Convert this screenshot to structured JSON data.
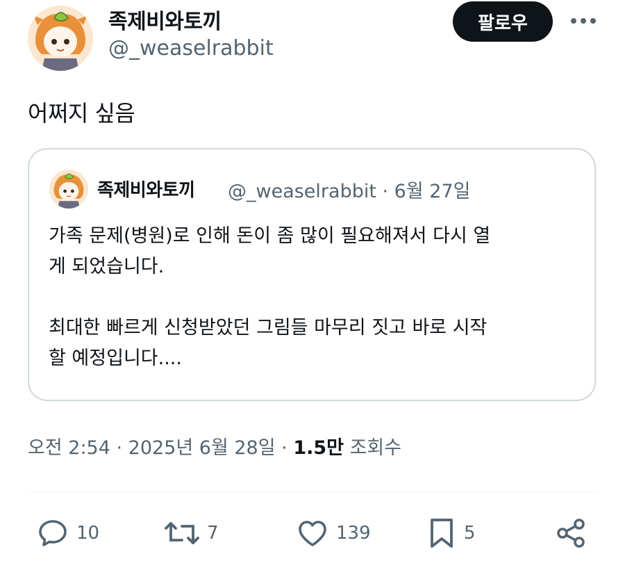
{
  "author": {
    "display_name": "족제비와토끼",
    "handle": "@_weaselrabbit",
    "avatar_icon": "avatar-illustration"
  },
  "follow_label": "팔로우",
  "more_icon": "more-icon",
  "tweet": {
    "text": "어쩌지 싶음"
  },
  "quoted": {
    "display_name": "족제비와토끼",
    "meta": "@_weaselrabbit · 6월 27일",
    "body": "가족 문제(병원)로 인해 돈이 좀 많이 필요해져서 다시 열\n게 되었습니다.\n\n최대한 빠르게 신청받았던 그림들 마무리 짓고 바로 시작\n할 예정입니다...."
  },
  "timestamp": {
    "time_date": "오전 2:54 · 2025년 6월 28일 · ",
    "views_count": "1.5만",
    "views_label": " 조회수"
  },
  "actions": {
    "reply_count": "10",
    "retweet_count": "7",
    "like_count": "139",
    "bookmark_count": "5"
  },
  "colors": {
    "text": "#0f1419",
    "secondary": "#536471",
    "border": "#cfd9de",
    "button_bg": "#0f1419"
  }
}
